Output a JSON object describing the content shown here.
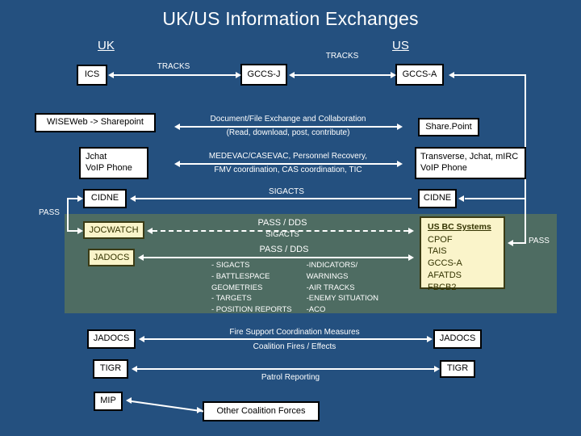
{
  "title": "UK/US Information Exchanges",
  "headings": {
    "uk": "UK",
    "us": "US"
  },
  "colors": {
    "background": "#24507F",
    "green_panel": "#4E6C62",
    "white_box": "#FFFFFF",
    "yellow_box": "#FAF4CA",
    "line": "#FFFFFF"
  },
  "rows": {
    "tracks": {
      "uk_box": "ICS",
      "mid_box": "GCCS-J",
      "us_box": "GCCS-A",
      "label_left": "TRACKS",
      "label_right": "TRACKS"
    },
    "sharepoint": {
      "uk_box": "WISEWeb -> Sharepoint",
      "us_box": "Share.Point",
      "label_line1": "Document/File Exchange and Collaboration",
      "label_line2": "(Read, download, post, contribute)"
    },
    "chat": {
      "uk_box_line1": "Jchat",
      "uk_box_line2": "VoIP Phone",
      "us_box_line1": "Transverse, Jchat, mIRC",
      "us_box_line2": "VoIP Phone",
      "label_line1": "MEDEVAC/CASEVAC, Personnel Recovery,",
      "label_line2": "FMV coordination, CAS coordination, TIC"
    },
    "cidne": {
      "uk_box": "CIDNE",
      "us_box": "CIDNE",
      "label": "SIGACTS"
    },
    "jocwatch": {
      "uk_box": "JOCWATCH",
      "label_line1": "PASS / DDS",
      "label_line2": "SIGACTS"
    },
    "jadocs_green": {
      "uk_box": "JADOCS",
      "label": "PASS / DDS"
    },
    "jadocs_bottom": {
      "uk_box": "JADOCS",
      "us_box": "JADOCS",
      "label_line1": "Fire Support Coordination Measures",
      "label_line2": "Coalition Fires / Effects"
    },
    "tigr": {
      "uk_box": "TIGR",
      "us_box": "TIGR",
      "label": "Patrol Reporting"
    },
    "mip": {
      "uk_box": "MIP",
      "other_box": "Other Coalition Forces"
    }
  },
  "pass_labels": {
    "left": "PASS",
    "right": "PASS"
  },
  "us_bc_systems": {
    "header": "US BC Systems",
    "items": [
      "CPOF",
      "TAIS",
      "GCCS-A",
      "AFATDS",
      "FBCB2"
    ]
  },
  "exchange_list": {
    "left_column": [
      "- SIGACTS",
      "- BATTLESPACE",
      "GEOMETRIES",
      "- TARGETS",
      "- POSITION REPORTS"
    ],
    "right_column": [
      "-INDICATORS/",
      "WARNINGS",
      "-AIR TRACKS",
      "-ENEMY SITUATION",
      "-ACO"
    ]
  }
}
